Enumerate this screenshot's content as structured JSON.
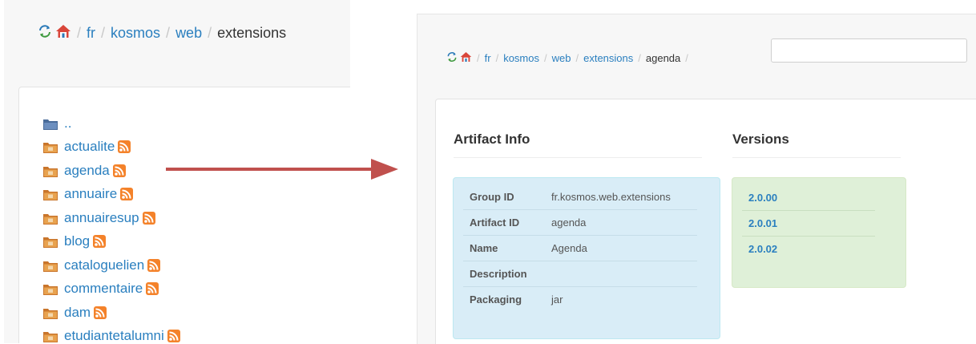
{
  "left": {
    "breadcrumb": {
      "crumbs": [
        "fr",
        "kosmos",
        "web"
      ],
      "current": "extensions",
      "separator": "/"
    },
    "parent_dir": "..",
    "folders": [
      "actualite",
      "agenda",
      "annuaire",
      "annuairesup",
      "blog",
      "cataloguelien",
      "commentaire",
      "dam",
      "etudiantetalumni"
    ]
  },
  "right": {
    "breadcrumb": {
      "crumbs": [
        "fr",
        "kosmos",
        "web",
        "extensions"
      ],
      "current": "agenda",
      "separator": "/"
    },
    "path_input_value": "",
    "artifact_info": {
      "title": "Artifact Info",
      "rows": [
        {
          "label": "Group ID",
          "value": "fr.kosmos.web.extensions"
        },
        {
          "label": "Artifact ID",
          "value": "agenda"
        },
        {
          "label": "Name",
          "value": "Agenda"
        },
        {
          "label": "Description",
          "value": ""
        },
        {
          "label": "Packaging",
          "value": "jar"
        }
      ]
    },
    "versions": {
      "title": "Versions",
      "items": [
        "2.0.00",
        "2.0.01",
        "2.0.02"
      ]
    }
  },
  "icons": {
    "refresh": "refresh-icon",
    "home": "home-icon",
    "folder": "folder-icon",
    "rss": "rss-feed-icon",
    "arrow": "arrow-right-icon"
  },
  "colors": {
    "link": "#2a7fbf",
    "rss_orange": "#f4822a",
    "arrow_red": "#c0504d",
    "info_bg": "#d9edf7",
    "versions_bg": "#dff0d8"
  }
}
